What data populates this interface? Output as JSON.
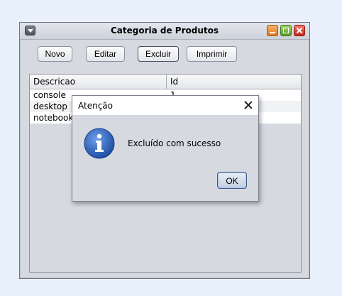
{
  "window": {
    "title": "Categoria de Produtos",
    "toolbar": {
      "novo": "Novo",
      "editar": "Editar",
      "excluir": "Excluir",
      "imprimir": "Imprimir"
    },
    "table": {
      "columns": [
        "Descricao",
        "Id"
      ],
      "rows": [
        [
          "console",
          "1"
        ],
        [
          "desktop",
          ""
        ],
        [
          "notebook",
          ""
        ]
      ]
    }
  },
  "dialog": {
    "title": "Atenção",
    "message": "Excluído com sucesso",
    "ok_label": "OK",
    "icon": "info-icon"
  },
  "colors": {
    "info_icon": "#2a5fb8",
    "window_bg": "#d6d9e0"
  }
}
